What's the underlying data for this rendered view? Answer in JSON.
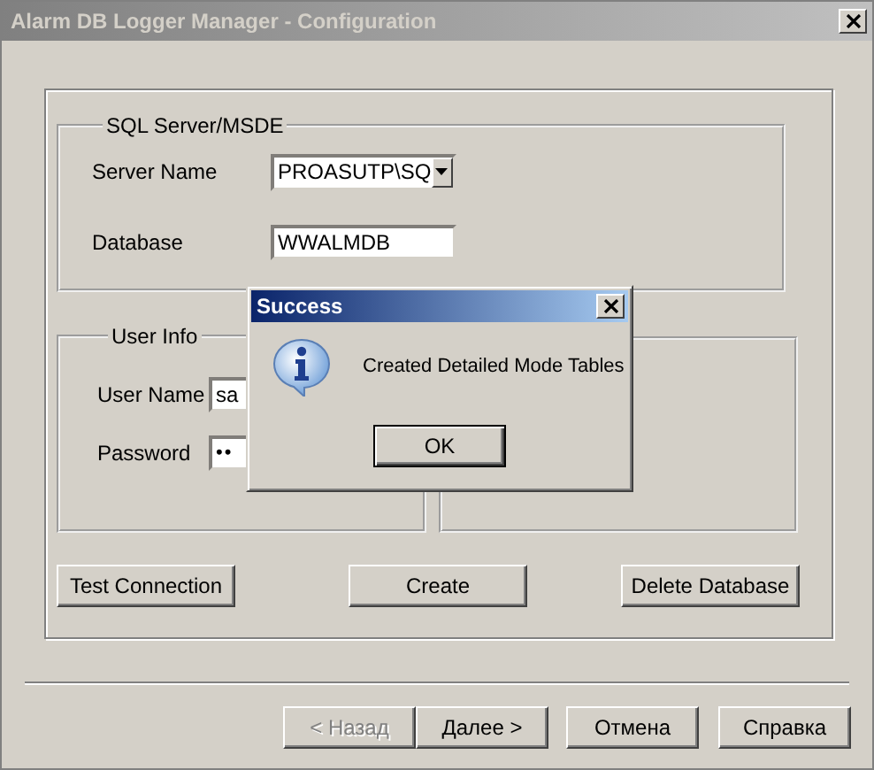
{
  "window": {
    "title": "Alarm DB Logger Manager - Configuration"
  },
  "sql_group": {
    "legend": "SQL Server/MSDE",
    "fields": [
      {
        "label": "Server Name",
        "kind": "combo",
        "value": "PROASUTP\\SQ"
      },
      {
        "label": "Database",
        "kind": "text",
        "value": "WWALMDB"
      }
    ]
  },
  "user_group": {
    "legend": "User Info",
    "fields": [
      {
        "label": "User Name",
        "kind": "text",
        "value": "sa"
      },
      {
        "label": "Password",
        "kind": "password",
        "value": "••"
      }
    ]
  },
  "actions": [
    {
      "label": "Test Connection"
    },
    {
      "label": "Create"
    },
    {
      "label": "Delete Database"
    }
  ],
  "wizard_buttons": [
    {
      "label": "< Назад",
      "disabled": true
    },
    {
      "label": "Далее >",
      "disabled": false
    },
    {
      "label": "Отмена",
      "disabled": false
    },
    {
      "label": "Справка",
      "disabled": false
    }
  ],
  "dialog": {
    "title": "Success",
    "message": "Created Detailed Mode Tables",
    "button": "OK"
  }
}
